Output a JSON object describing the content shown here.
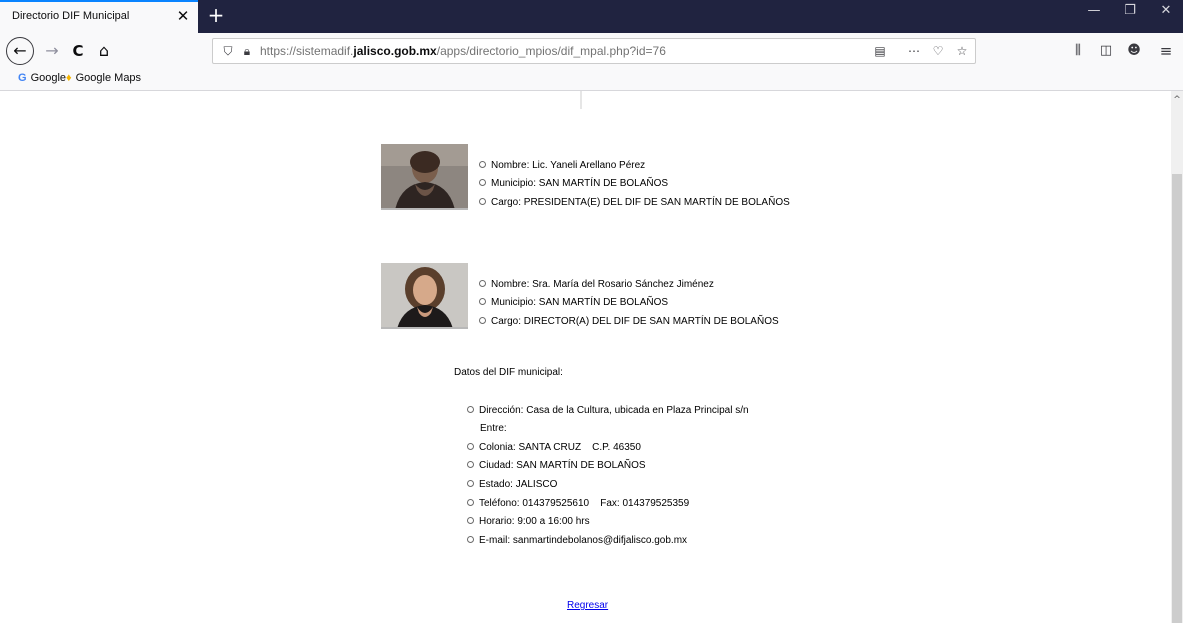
{
  "browser": {
    "tab_title": "Directorio DIF Municipal",
    "tab_close": "✕",
    "new_tab": "+",
    "url_prefix": "https://sistemadif.",
    "url_domain": "jalisco.gob.mx",
    "url_path": "/apps/directorio_mpios/dif_mpal.php?id=76",
    "window_controls": {
      "minimize": "—",
      "maximize": "❐",
      "close": "✕"
    }
  },
  "bookmarks": [
    {
      "label": "Google",
      "icon": "google-icon",
      "glyph": "G",
      "color": "#4285f4"
    },
    {
      "label": "Google Maps",
      "icon": "maps-pin-icon",
      "glyph": "♦",
      "color": "#f4b400"
    }
  ],
  "people": [
    {
      "nombre": "Nombre: Lic. Yaneli Arellano Pérez",
      "municipio": "Municipio: SAN MARTÍN DE BOLAÑOS",
      "cargo": "Cargo: PRESIDENTA(E) DEL DIF DE SAN MARTÍN DE BOLAÑOS"
    },
    {
      "nombre": "Nombre: Sra. María del Rosario Sánchez Jiménez",
      "municipio": "Municipio: SAN MARTÍN DE BOLAÑOS",
      "cargo": "Cargo: DIRECTOR(A) DEL DIF DE SAN MARTÍN DE BOLAÑOS"
    }
  ],
  "datos": {
    "heading": "Datos del DIF municipal:",
    "direccion": "Dirección: Casa de la Cultura, ubicada en Plaza Principal s/n",
    "entre": "Entre:",
    "colonia": "Colonia: SANTA CRUZ    C.P. 46350",
    "ciudad": "Ciudad: SAN MARTÍN DE BOLAÑOS",
    "estado": "Estado: JALISCO",
    "telefono": "Teléfono: 014379525610    Fax: 014379525359",
    "horario": "Horario: 9:00 a 16:00 hrs",
    "email": "E-mail: sanmartindebolanos@difjalisco.gob.mx"
  },
  "regresar": "Regresar",
  "colors": {
    "accent": "#0a84ff",
    "titlebar": "#202340",
    "link": "#0000ee"
  }
}
